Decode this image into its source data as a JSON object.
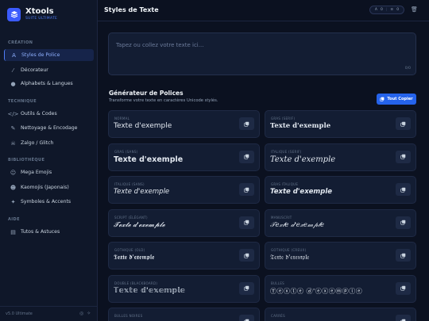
{
  "brand": {
    "title": "Xtools",
    "subtitle": "SUITE ULTIMATE"
  },
  "sidebar": {
    "sections": [
      {
        "title": "CRÉATION",
        "items": [
          {
            "label": "Styles de Police",
            "icon": "font-icon",
            "active": true
          },
          {
            "label": "Décorateur",
            "icon": "magic-wand-icon"
          },
          {
            "label": "Alphabets & Langues",
            "icon": "globe-icon"
          }
        ]
      },
      {
        "title": "TECHNIQUE",
        "items": [
          {
            "label": "Outils & Codes",
            "icon": "code-icon"
          },
          {
            "label": "Nettoyage & Encodage",
            "icon": "brush-icon"
          },
          {
            "label": "Zalgo / Glitch",
            "icon": "skull-icon"
          }
        ]
      },
      {
        "title": "BIBLIOTHÈQUE",
        "items": [
          {
            "label": "Mega Emojis",
            "icon": "smile-icon"
          },
          {
            "label": "Kaomojis (Japonais)",
            "icon": "face-icon"
          },
          {
            "label": "Symboles & Accents",
            "icon": "icons-icon"
          }
        ]
      },
      {
        "title": "AIDE",
        "items": [
          {
            "label": "Tutos & Astuces",
            "icon": "book-icon"
          }
        ]
      }
    ],
    "version": "v5.0 Ultimate"
  },
  "header": {
    "title": "Styles de Texte",
    "stat_a": "0",
    "stat_b": "0"
  },
  "input": {
    "placeholder": "Tapez ou collez votre texte ici...",
    "count": "0/0"
  },
  "generator": {
    "title": "Générateur de Polices",
    "subtitle": "Transforme votre texte en caractères Unicode stylés.",
    "copy_all": "Tout Copier"
  },
  "cards": [
    {
      "label": "NORMAL",
      "sample": "Texte d'exemple",
      "style": "s-normal"
    },
    {
      "label": "GRAS (SERIF)",
      "sample": "Texte d'exemple",
      "style": "s-bold-serif"
    },
    {
      "label": "GRAS (SANS)",
      "sample": "Texte d'exemple",
      "style": "s-bold-sans"
    },
    {
      "label": "ITALIQUE (SERIF)",
      "sample": "Texte d'exemple",
      "style": "s-italic-serif"
    },
    {
      "label": "ITALIQUE (SANS)",
      "sample": "Texte d'exemple",
      "style": "s-italic-sans"
    },
    {
      "label": "GRAS ITALIQUE",
      "sample": "Texte d'exemple",
      "style": "s-bold-italic"
    },
    {
      "label": "SCRIPT (ÉLÉGANT)",
      "sample": "𝓣𝓮𝔁𝓽𝓮 𝓭'𝓮𝔁𝓮𝓶𝓹𝓵𝓮",
      "style": "s-script"
    },
    {
      "label": "MANUSCRIT",
      "sample": "𝒯𝑒𝓍𝓉𝑒 𝒹'𝑒𝓍𝑒𝓂𝓅𝓁𝑒",
      "style": "s-manuscript"
    },
    {
      "label": "GOTHIQUE (OLD)",
      "sample": "𝕿𝖊𝖝𝖙𝖊 𝖉'𝖊𝖝𝖊𝖒𝖕𝖑𝖊",
      "style": "s-gothic"
    },
    {
      "label": "GOTHIQUE (CREUX)",
      "sample": "𝔗𝔢𝔵𝔱𝔢 𝔡'𝔢𝔵𝔢𝔪𝔭𝔩𝔢",
      "style": "s-gothic"
    },
    {
      "label": "DOUBLE (BLACKBOARD)",
      "sample": "𝕋𝕖𝕩𝕥𝕖 𝕕'𝕖𝕩𝕖𝕞𝕡𝕝𝕖",
      "style": "s-double"
    },
    {
      "label": "BULLES",
      "sample": "Ⓣⓔⓧⓣⓔ ⓓ'ⓔⓧⓔⓜⓟⓛⓔ",
      "style": "s-bubble"
    },
    {
      "label": "BULLES NOIRES",
      "sample": "",
      "style": "s-bubble"
    },
    {
      "label": "CARRÉS",
      "sample": "🅃🄴🅇🅃🄴",
      "style": "s-square"
    }
  ]
}
